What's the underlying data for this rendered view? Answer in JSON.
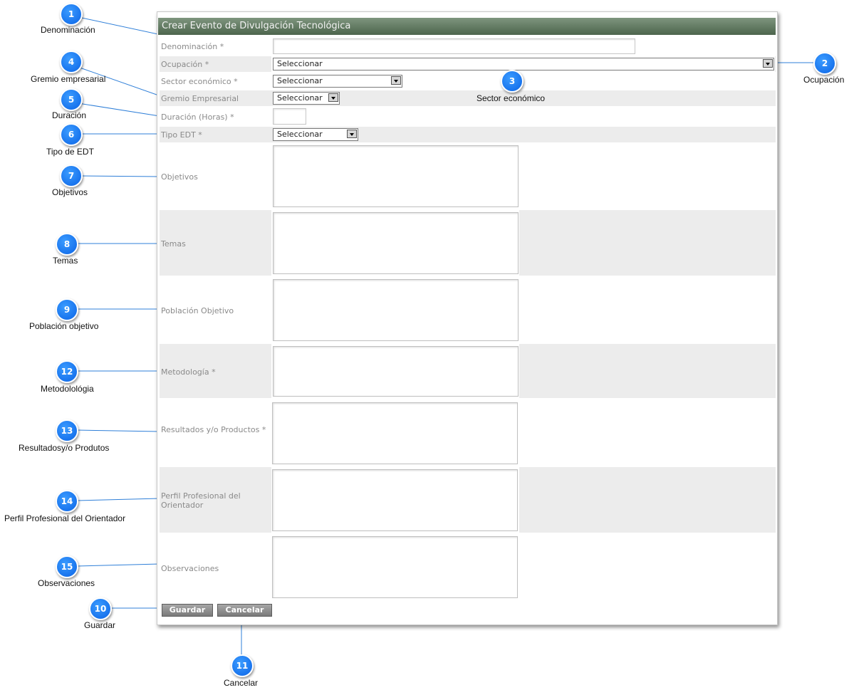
{
  "form": {
    "title": "Crear Evento de Divulgación Tecnológica",
    "fields": {
      "denominacion": "Denominación *",
      "ocupacion": "Ocupación *",
      "sector": "Sector económico *",
      "gremio": "Gremio Empresarial",
      "duracion": "Duración (Horas) *",
      "tipo_edt": "Tipo EDT *",
      "objetivos": "Objetivos",
      "temas": "Temas",
      "poblacion": "Población Objetivo",
      "metodologia": "Metodología *",
      "resultados": "Resultados y/o Productos *",
      "perfil": "Perfil Profesional del Orientador",
      "observaciones": "Observaciones"
    },
    "select_placeholder": "Seleccionar",
    "buttons": {
      "save": "Guardar",
      "cancel": "Cancelar"
    }
  },
  "callouts": [
    {
      "n": "1",
      "label": "Denominación"
    },
    {
      "n": "2",
      "label": "Ocupación"
    },
    {
      "n": "3",
      "label": "Sector económico"
    },
    {
      "n": "4",
      "label": "Gremio empresarial"
    },
    {
      "n": "5",
      "label": "Duración"
    },
    {
      "n": "6",
      "label": "Tipo de EDT"
    },
    {
      "n": "7",
      "label": "Objetivos"
    },
    {
      "n": "8",
      "label": "Temas"
    },
    {
      "n": "9",
      "label": "Población objetivo"
    },
    {
      "n": "12",
      "label": "Metodolológia"
    },
    {
      "n": "13",
      "label": "Resultadosy/o Produtos"
    },
    {
      "n": "14",
      "label": "Perfil Profesional del Orientador"
    },
    {
      "n": "15",
      "label": "Observaciones"
    },
    {
      "n": "10",
      "label": "Guardar"
    },
    {
      "n": "11",
      "label": "Cancelar"
    }
  ],
  "colors": {
    "callout": "#0a63e6",
    "title_bar": "#5f765f",
    "leader_line": "#2f7fd8"
  }
}
